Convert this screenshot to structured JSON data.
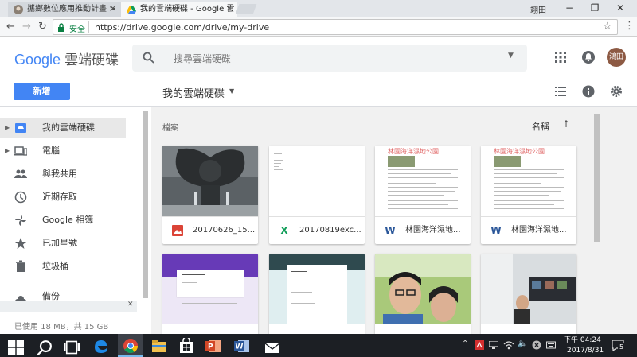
{
  "browser": {
    "tabs": [
      {
        "title": "攜鄉數位應用推動計畫 >",
        "active": false
      },
      {
        "title": "我的雲端硬碟 - Google 雲",
        "active": true
      }
    ],
    "user_label": "翊田",
    "url_secure_label": "安全",
    "url_text": "https://drive.google.com/drive/my-drive"
  },
  "drive": {
    "logo_google": "Google",
    "logo_product": "雲端硬碟",
    "search_placeholder": "搜尋雲端硬碟",
    "avatar_text": "鴻田",
    "new_button": "新增",
    "location_title": "我的雲端硬碟",
    "files_heading": "檔案",
    "sort_label": "名稱"
  },
  "sidebar": {
    "items": [
      {
        "label": "我的雲端硬碟",
        "icon": "drive-icon",
        "active": true
      },
      {
        "label": "電腦",
        "icon": "computer-icon",
        "active": false
      },
      {
        "label": "與我共用",
        "icon": "shared-icon",
        "active": false
      },
      {
        "label": "近期存取",
        "icon": "clock-icon",
        "active": false
      },
      {
        "label": "Google 相簿",
        "icon": "photos-icon",
        "active": false
      },
      {
        "label": "已加星號",
        "icon": "star-icon",
        "active": false
      },
      {
        "label": "垃圾桶",
        "icon": "trash-icon",
        "active": false
      }
    ],
    "partial_item": "備份",
    "storage_text": "已使用 18 MB，共 15 GB"
  },
  "files": [
    {
      "name": "20170626_15...",
      "type": "image",
      "icon": "image-icon"
    },
    {
      "name": "20170819exc...",
      "type": "sheet",
      "icon": "sheets-icon",
      "icon_char": "X"
    },
    {
      "name": "林園海洋濕地...",
      "type": "doc",
      "icon": "word-icon",
      "icon_char": "W",
      "thumb_title": "林園海洋濕地公園"
    },
    {
      "name": "林園海洋濕地...",
      "type": "doc",
      "icon": "word-icon",
      "icon_char": "W",
      "thumb_title": "林園海洋濕地公園"
    },
    {
      "name": "",
      "type": "form"
    },
    {
      "name": "",
      "type": "form-teal"
    },
    {
      "name": "",
      "type": "photo"
    },
    {
      "name": "",
      "type": "photo-room"
    }
  ],
  "taskbar": {
    "time": "下午 04:24",
    "date": "2017/8/31",
    "notification_count": "5"
  },
  "colors": {
    "accent_blue": "#4285f4",
    "sheets_green": "#0f9d58",
    "word_blue": "#2a5699",
    "image_red": "#db4437"
  }
}
